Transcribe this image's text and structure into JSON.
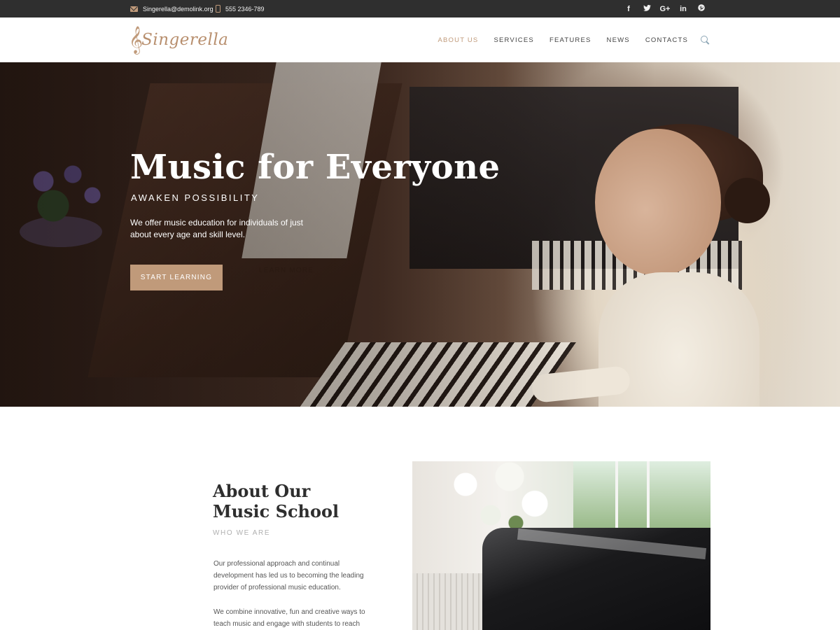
{
  "topbar": {
    "email": "Singerella@demolink.org",
    "phone": "555 2346-789",
    "socials": [
      "f",
      "t",
      "G+",
      "in",
      "p"
    ],
    "icons": [
      "mail-icon",
      "phone-icon",
      "facebook-icon",
      "twitter-icon",
      "google-plus-icon",
      "linkedin-icon",
      "pinterest-icon"
    ]
  },
  "header": {
    "logo_text": "Singerella",
    "logo_mark": "𝄞",
    "nav": [
      {
        "label": "ABOUT US",
        "active": true
      },
      {
        "label": "SERVICES",
        "active": false
      },
      {
        "label": "FEATURES",
        "active": false
      },
      {
        "label": "NEWS",
        "active": false
      },
      {
        "label": "CONTACTS",
        "active": false
      }
    ],
    "search_icon": "search-icon"
  },
  "hero": {
    "title": "Music for Everyone",
    "subtitle": "AWAKEN POSSIBILITY",
    "description": "We offer music education for individuals of just about every age and skill level.",
    "cta_label": "START LEARNING",
    "secondary_label": "LEARN MORE"
  },
  "about": {
    "heading_line1": "About Our",
    "heading_line2": "Music School",
    "kicker": "WHO WE ARE",
    "paragraph1": "Our professional approach and continual development has led us to becoming the leading provider of professional music education.",
    "paragraph2": "We combine innovative, fun and creative ways to teach music and engage with students to reach their"
  },
  "colors": {
    "accent": "#c09a7a",
    "topbar_bg": "#2f2f2f",
    "nav_text": "#444444",
    "muted": "#b0b0b0"
  }
}
